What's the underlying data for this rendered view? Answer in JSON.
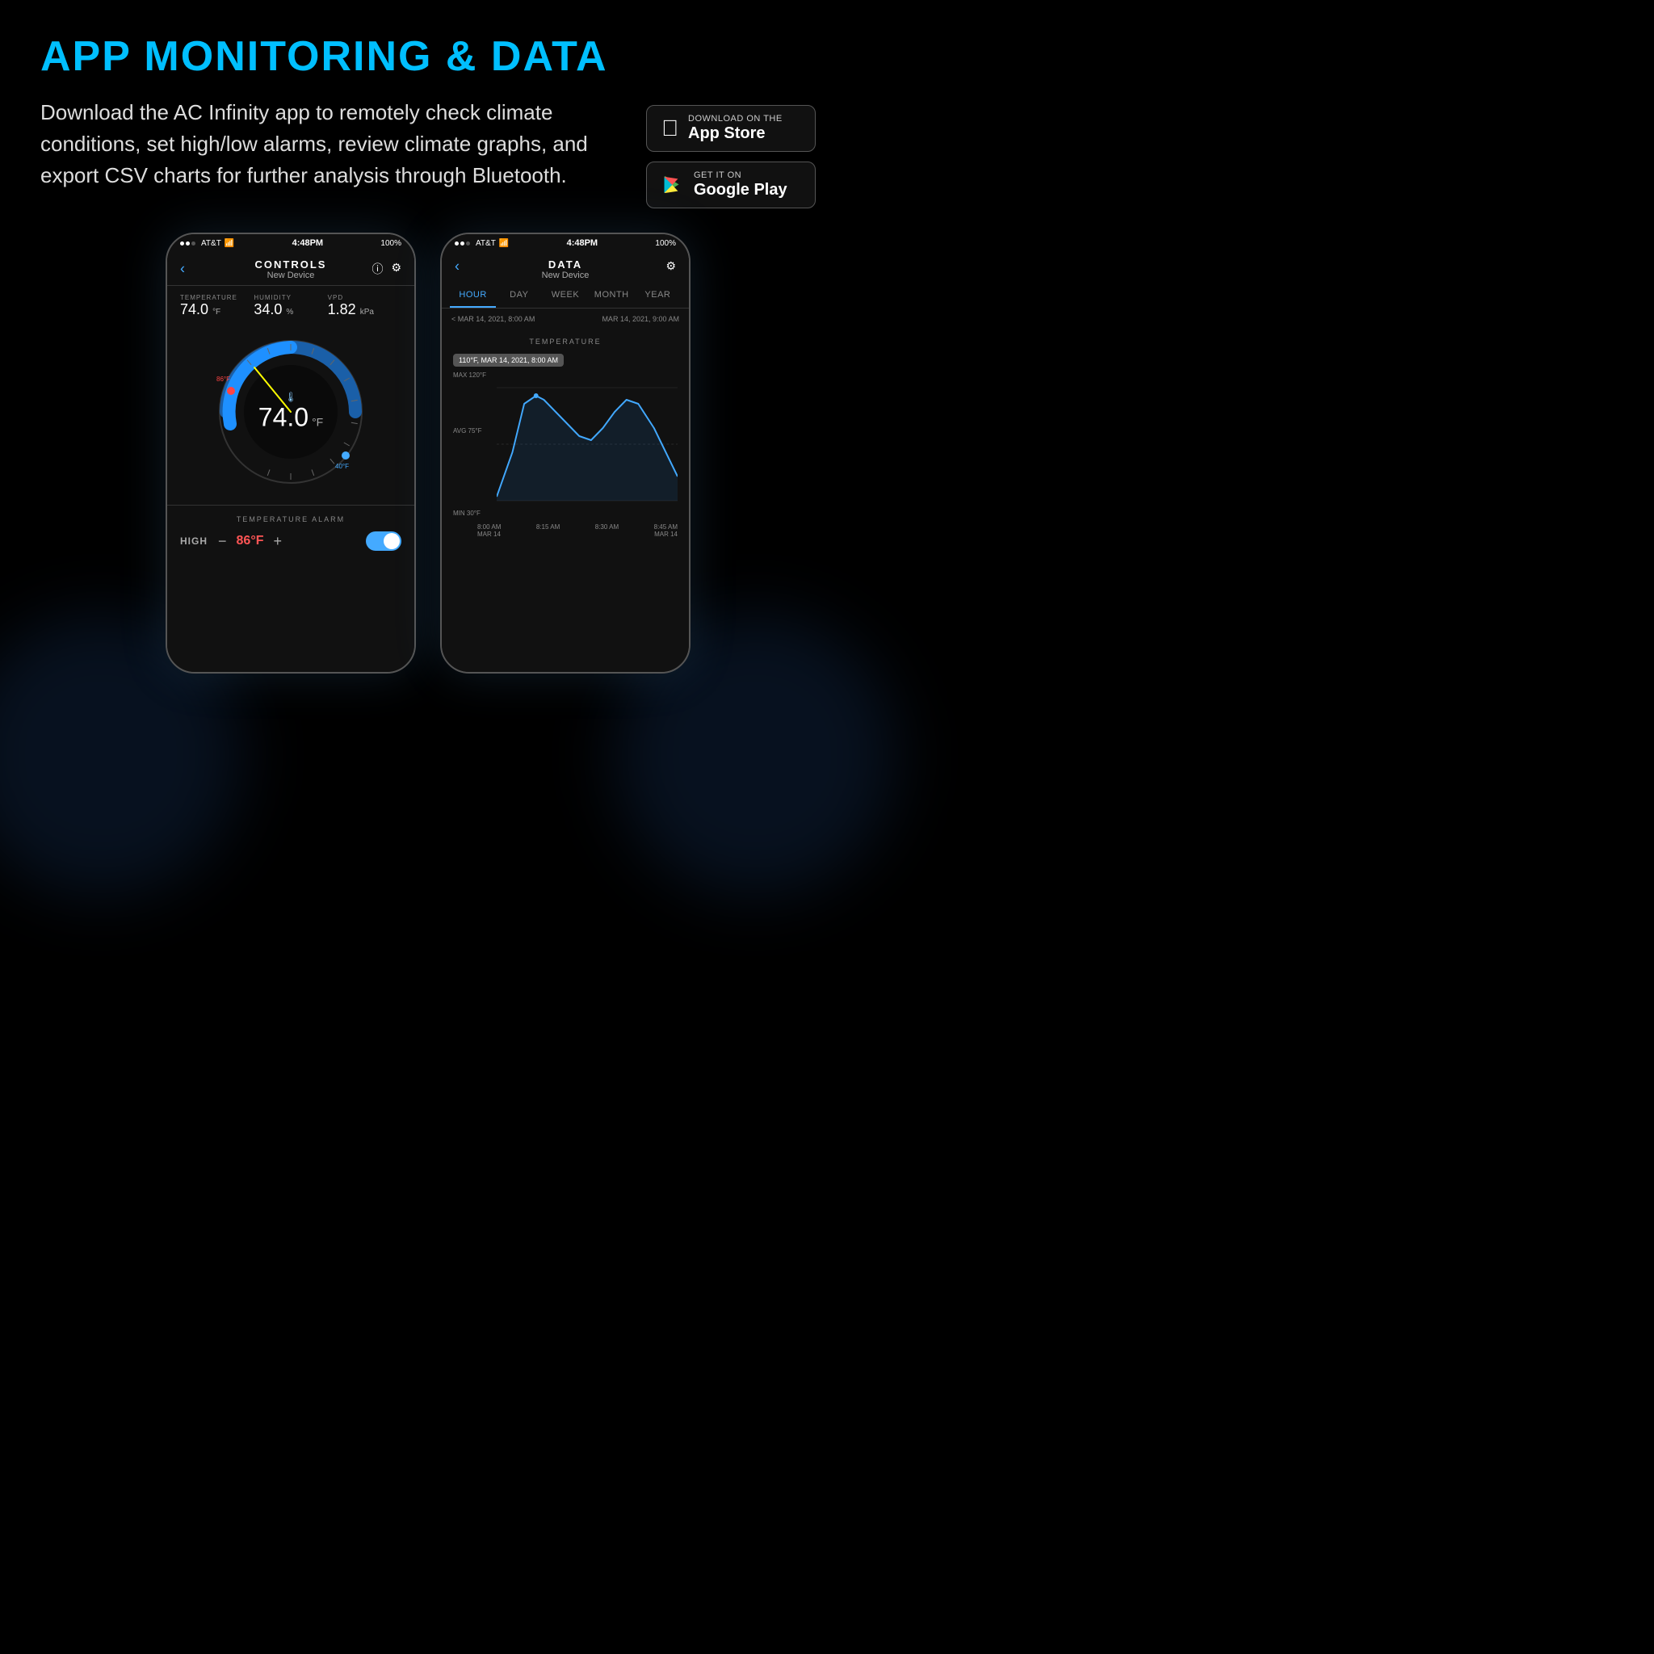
{
  "page": {
    "title": "APP MONITORING & DATA",
    "description": "Download the AC Infinity app to remotely check climate conditions, set high/low alarms, review climate graphs, and export CSV charts for further analysis through Bluetooth.",
    "bg_color": "#000000"
  },
  "badges": [
    {
      "id": "app-store",
      "sub_label": "Download on the",
      "main_label": "App Store",
      "icon": "apple"
    },
    {
      "id": "google-play",
      "sub_label": "GET IT ON",
      "main_label": "Google Play",
      "icon": "play"
    }
  ],
  "phone_controls": {
    "status": {
      "carrier": "AT&T",
      "time": "4:48PM",
      "battery": "100%"
    },
    "header": {
      "title": "CONTROLS",
      "subtitle": "New Device"
    },
    "sensors": [
      {
        "label": "TEMPERATURE",
        "value": "74.0",
        "unit": "°F"
      },
      {
        "label": "HUMIDITY",
        "value": "34.0",
        "unit": "%"
      },
      {
        "label": "VPD",
        "value": "1.82",
        "unit": "kPa"
      }
    ],
    "gauge": {
      "temp": "74.0",
      "unit": "°F",
      "high_marker": "86°F",
      "low_marker": "40°F"
    },
    "alarm": {
      "section_title": "TEMPERATURE ALARM",
      "type": "HIGH",
      "value": "86°F",
      "enabled": true
    }
  },
  "phone_data": {
    "status": {
      "carrier": "AT&T",
      "time": "4:48PM",
      "battery": "100%"
    },
    "header": {
      "title": "DATA",
      "subtitle": "New Device"
    },
    "tabs": [
      "HOUR",
      "DAY",
      "WEEK",
      "MONTH",
      "YEAR"
    ],
    "active_tab": "HOUR",
    "date_range": {
      "start": "< MAR 14, 2021, 8:00 AM",
      "end": "MAR 14, 2021, 9:00 AM"
    },
    "chart": {
      "title": "TEMPERATURE",
      "tooltip": "110°F, MAR 14, 2021, 8:00 AM",
      "y_labels": [
        "MAX 120°F",
        "AVG 75°F",
        "MIN 30°F"
      ],
      "x_labels": [
        "8:00 AM",
        "8:15 AM",
        "8:30 AM",
        "8:45 AM"
      ],
      "x_dates": [
        "MAR 14",
        "",
        "",
        "MAR 14"
      ]
    }
  }
}
